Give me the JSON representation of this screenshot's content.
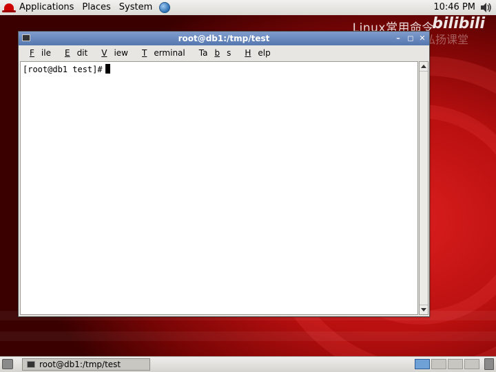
{
  "top_panel": {
    "menus": [
      "Applications",
      "Places",
      "System"
    ],
    "clock": "10:46 PM",
    "icons": [
      "redhat-icon",
      "globe-icon",
      "volume-icon"
    ]
  },
  "watermark": {
    "text": "Linux常用命令",
    "logo": "bilibili",
    "sub": "弘扬课堂"
  },
  "terminal": {
    "title": "root@db1:/tmp/test",
    "menu": [
      {
        "label": "File",
        "u": "F",
        "rest": "ile"
      },
      {
        "label": "Edit",
        "u": "E",
        "rest": "dit"
      },
      {
        "label": "View",
        "u": "V",
        "rest": "iew"
      },
      {
        "label": "Terminal",
        "u": "T",
        "rest": "erminal"
      },
      {
        "label": "Tabs",
        "pre": "Ta",
        "u": "b",
        "rest": "s"
      },
      {
        "label": "Help",
        "u": "H",
        "rest": "elp"
      }
    ],
    "prompt": "[root@db1 test]#"
  },
  "taskbar": {
    "task_label": "root@db1:/tmp/test"
  },
  "colors": {
    "titlebar": "#5577b0",
    "desktop": "#b80f0f"
  }
}
